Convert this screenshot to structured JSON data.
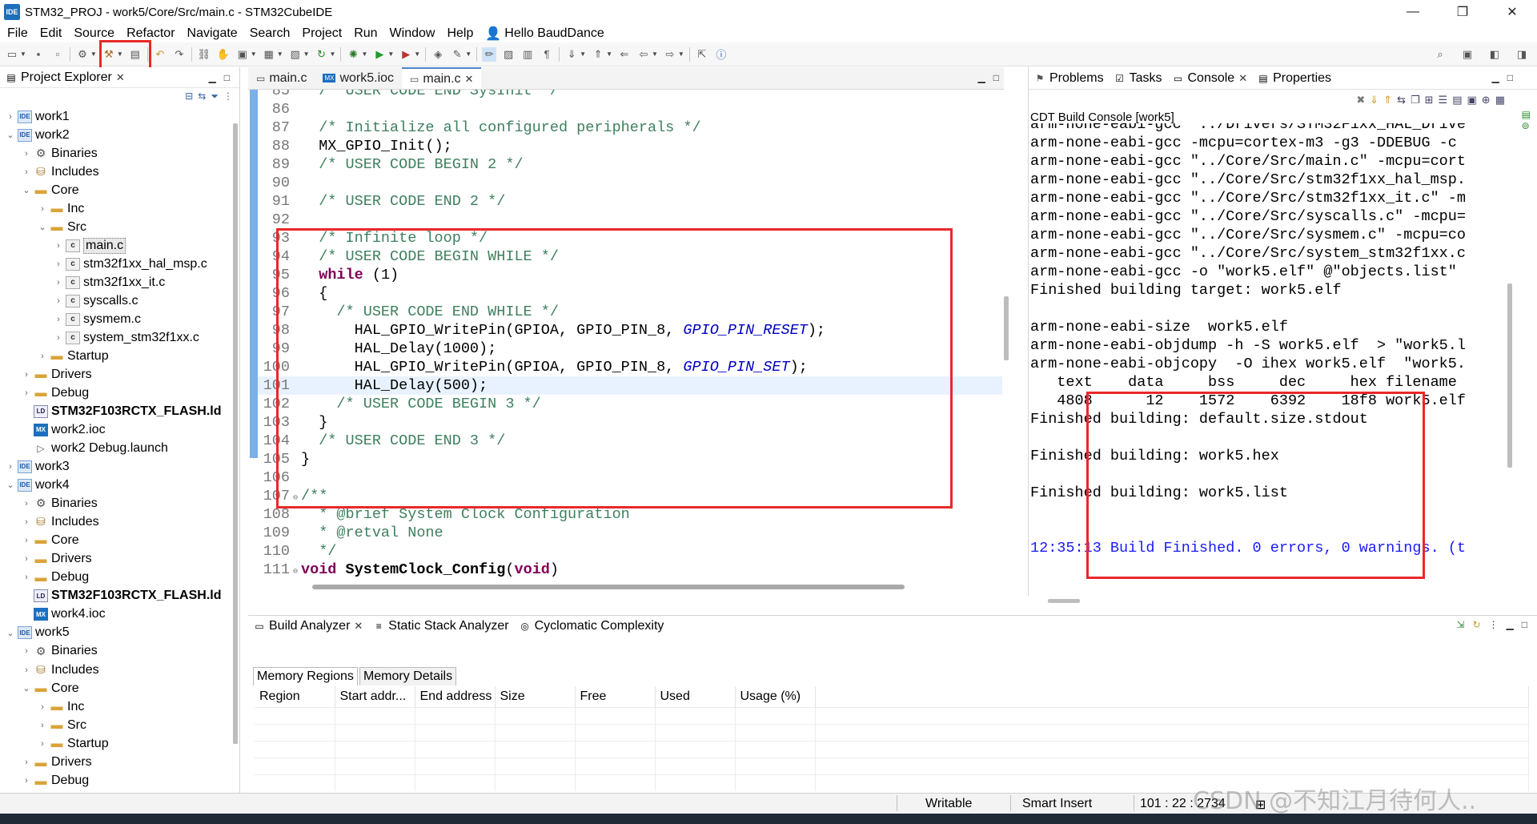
{
  "window": {
    "title": "STM32_PROJ - work5/Core/Src/main.c - STM32CubeIDE",
    "app_icon": "IDE",
    "minimize": "—",
    "maximize": "❐",
    "close": "✕"
  },
  "menu": [
    "File",
    "Edit",
    "Source",
    "Refactor",
    "Navigate",
    "Search",
    "Project",
    "Run",
    "Window",
    "Help"
  ],
  "user_greeting": "Hello BaudDance",
  "explorer": {
    "title": "Project Explorer",
    "tree": [
      {
        "label": "work1",
        "icon": "project",
        "expander": "›"
      },
      {
        "label": "work2",
        "icon": "project",
        "expander": "⌄"
      },
      {
        "label": "Binaries",
        "icon": "binaries",
        "expander": "›"
      },
      {
        "label": "Includes",
        "icon": "includes",
        "expander": "›"
      },
      {
        "label": "Core",
        "icon": "folder",
        "expander": "⌄"
      },
      {
        "label": "Inc",
        "icon": "folder",
        "expander": "›"
      },
      {
        "label": "Src",
        "icon": "folder",
        "expander": "⌄"
      },
      {
        "label": "main.c",
        "icon": "c-file",
        "expander": "›"
      },
      {
        "label": "stm32f1xx_hal_msp.c",
        "icon": "c-file",
        "expander": "›"
      },
      {
        "label": "stm32f1xx_it.c",
        "icon": "c-file",
        "expander": "›"
      },
      {
        "label": "syscalls.c",
        "icon": "c-file",
        "expander": "›"
      },
      {
        "label": "sysmem.c",
        "icon": "c-file",
        "expander": "›"
      },
      {
        "label": "system_stm32f1xx.c",
        "icon": "c-file",
        "expander": "›"
      },
      {
        "label": "Startup",
        "icon": "folder",
        "expander": "›"
      },
      {
        "label": "Drivers",
        "icon": "folder",
        "expander": "›"
      },
      {
        "label": "Debug",
        "icon": "folder",
        "expander": "›"
      },
      {
        "label": "STM32F103RCTX_FLASH.ld",
        "icon": "ld-file",
        "expander": ""
      },
      {
        "label": "work2.ioc",
        "icon": "mx-file",
        "expander": ""
      },
      {
        "label": "work2 Debug.launch",
        "icon": "launch-file",
        "expander": ""
      },
      {
        "label": "work3",
        "icon": "project",
        "expander": "›"
      },
      {
        "label": "work4",
        "icon": "project",
        "expander": "⌄"
      },
      {
        "label": "Binaries",
        "icon": "binaries",
        "expander": "›"
      },
      {
        "label": "Includes",
        "icon": "includes",
        "expander": "›"
      },
      {
        "label": "Core",
        "icon": "folder",
        "expander": "›"
      },
      {
        "label": "Drivers",
        "icon": "folder",
        "expander": "›"
      },
      {
        "label": "Debug",
        "icon": "folder",
        "expander": "›"
      },
      {
        "label": "STM32F103RCTX_FLASH.ld",
        "icon": "ld-file",
        "expander": ""
      },
      {
        "label": "work4.ioc",
        "icon": "mx-file",
        "expander": ""
      },
      {
        "label": "work5",
        "icon": "project",
        "expander": "⌄"
      },
      {
        "label": "Binaries",
        "icon": "binaries",
        "expander": "›"
      },
      {
        "label": "Includes",
        "icon": "includes",
        "expander": "›"
      },
      {
        "label": "Core",
        "icon": "folder",
        "expander": "⌄"
      },
      {
        "label": "Inc",
        "icon": "folder",
        "expander": "›"
      },
      {
        "label": "Src",
        "icon": "folder",
        "expander": "›"
      },
      {
        "label": "Startup",
        "icon": "folder",
        "expander": "›"
      },
      {
        "label": "Drivers",
        "icon": "folder",
        "expander": "›"
      },
      {
        "label": "Debug",
        "icon": "folder",
        "expander": "›"
      }
    ]
  },
  "editor": {
    "tabs": [
      {
        "label": "main.c",
        "icon": "c-file-icon"
      },
      {
        "label": "work5.ioc",
        "icon": "mx-file-icon"
      },
      {
        "label": "main.c",
        "icon": "c-file-icon",
        "active": true,
        "close": "✕"
      }
    ],
    "lines": [
      {
        "n": "85",
        "text": "  /* USER CODE END SysInit */"
      },
      {
        "n": "86",
        "text": ""
      },
      {
        "n": "87",
        "text": "  /* Initialize all configured peripherals */"
      },
      {
        "n": "88",
        "text": "  MX_GPIO_Init();"
      },
      {
        "n": "89",
        "text": "  /* USER CODE BEGIN 2 */"
      },
      {
        "n": "90",
        "text": ""
      },
      {
        "n": "91",
        "text": "  /* USER CODE END 2 */"
      },
      {
        "n": "92",
        "text": ""
      },
      {
        "n": "93",
        "text": "  /* Infinite loop */"
      },
      {
        "n": "94",
        "text": "  /* USER CODE BEGIN WHILE */"
      },
      {
        "n": "95",
        "text": "  while (1)"
      },
      {
        "n": "96",
        "text": "  {"
      },
      {
        "n": "97",
        "text": "    /* USER CODE END WHILE */"
      },
      {
        "n": "98",
        "text": "      HAL_GPIO_WritePin(GPIOA, GPIO_PIN_8, GPIO_PIN_RESET);"
      },
      {
        "n": "99",
        "text": "      HAL_Delay(1000);"
      },
      {
        "n": "100",
        "text": "      HAL_GPIO_WritePin(GPIOA, GPIO_PIN_8, GPIO_PIN_SET);"
      },
      {
        "n": "101",
        "text": "      HAL_Delay(500);"
      },
      {
        "n": "102",
        "text": "    /* USER CODE BEGIN 3 */"
      },
      {
        "n": "103",
        "text": "  }"
      },
      {
        "n": "104",
        "text": "  /* USER CODE END 3 */"
      },
      {
        "n": "105",
        "text": "}"
      },
      {
        "n": "106",
        "text": ""
      },
      {
        "n": "107",
        "text": "/**"
      },
      {
        "n": "108",
        "text": "  * @brief System Clock Configuration"
      },
      {
        "n": "109",
        "text": "  * @retval None"
      },
      {
        "n": "110",
        "text": "  */"
      },
      {
        "n": "111",
        "text": "void SystemClock_Config(void)"
      }
    ]
  },
  "console_panel": {
    "tabs": [
      "Problems",
      "Tasks",
      "Console",
      "Properties"
    ],
    "close_label": "✕",
    "title": "CDT Build Console [work5]",
    "lines": [
      {
        "text": "arm-none-eabi-gcc \"../Drivers/STM32F1xx_HAL_Drive"
      },
      {
        "text": "arm-none-eabi-gcc -mcpu=cortex-m3 -g3 -DDEBUG -c"
      },
      {
        "text": "arm-none-eabi-gcc \"../Core/Src/main.c\" -mcpu=cort"
      },
      {
        "text": "arm-none-eabi-gcc \"../Core/Src/stm32f1xx_hal_msp."
      },
      {
        "text": "arm-none-eabi-gcc \"../Core/Src/stm32f1xx_it.c\" -m"
      },
      {
        "text": "arm-none-eabi-gcc \"../Core/Src/syscalls.c\" -mcpu="
      },
      {
        "text": "arm-none-eabi-gcc \"../Core/Src/sysmem.c\" -mcpu=co"
      },
      {
        "text": "arm-none-eabi-gcc \"../Core/Src/system_stm32f1xx.c"
      },
      {
        "text": "arm-none-eabi-gcc -o \"work5.elf\" @\"objects.list\" "
      },
      {
        "text": "Finished building target: work5.elf"
      },
      {
        "text": ""
      },
      {
        "text": "arm-none-eabi-size  work5.elf"
      },
      {
        "text": "arm-none-eabi-objdump -h -S work5.elf  > \"work5.l"
      },
      {
        "text": "arm-none-eabi-objcopy  -O ihex work5.elf  \"work5."
      },
      {
        "text": "   text    data     bss     dec     hex filename"
      },
      {
        "text": "   4808      12    1572    6392    18f8 work5.elf"
      },
      {
        "text": "Finished building: default.size.stdout"
      },
      {
        "text": ""
      },
      {
        "text": "Finished building: work5.hex"
      },
      {
        "text": ""
      },
      {
        "text": "Finished building: work5.list"
      },
      {
        "text": ""
      },
      {
        "text": ""
      },
      {
        "text": "12:35:13 Build Finished. 0 errors, 0 warnings. (t",
        "status": "finished"
      }
    ]
  },
  "analyzer": {
    "tabs": [
      "Build Analyzer",
      "Static Stack Analyzer",
      "Cyclomatic Complexity"
    ],
    "close_label": "✕",
    "sub_tabs": [
      "Memory Regions",
      "Memory Details"
    ],
    "columns": [
      "Region",
      "Start addr...",
      "End address",
      "Size",
      "Free",
      "Used",
      "Usage (%)"
    ]
  },
  "status": {
    "writable": "Writable",
    "insert_mode": "Smart Insert",
    "position": "101 : 22 : 2734"
  },
  "watermark": "CSDN @不知江月待何人.."
}
